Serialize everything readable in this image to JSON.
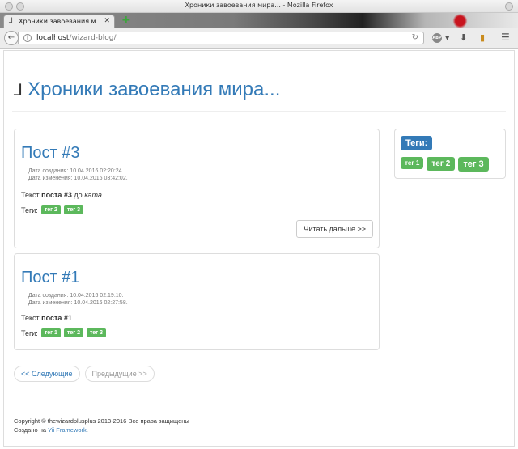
{
  "window": {
    "title": "Хроники завоевания мира... - Mozilla Firefox"
  },
  "browser": {
    "tab_title": "Хроники завоевания м...",
    "url_host": "localhost",
    "url_path": "/wizard-blog/",
    "abp_label": "ABP"
  },
  "site": {
    "title": "Хроники завоевания мира..."
  },
  "posts": [
    {
      "title": "Пост #3",
      "created": "Дата создания: 10.04.2016 02:20:24.",
      "modified": "Дата изменения: 10.04.2016 03:42:02.",
      "text_before": "Текст ",
      "text_bold": "поста #3",
      "text_middle": " до ",
      "text_italic": "ката",
      "text_after": ".",
      "tags_label": "Теги:",
      "tags": [
        "тег 2",
        "тег 3"
      ],
      "read_more": "Читать дальше >>"
    },
    {
      "title": "Пост #1",
      "created": "Дата создания: 10.04.2016 02:19:10.",
      "modified": "Дата изменения: 10.04.2016 02:27:58.",
      "text_before": "Текст ",
      "text_bold": "поста #1",
      "text_after": ".",
      "tags_label": "Теги:",
      "tags": [
        "тег 1",
        "тег 2",
        "тег 3"
      ]
    }
  ],
  "sidebar": {
    "heading": "Теги:",
    "tags": [
      "тег 1",
      "тег 2",
      "тег 3"
    ]
  },
  "pager": {
    "next": "<< Следующие",
    "prev": "Предыдущие >>"
  },
  "footer": {
    "copyright": "Copyright © thewizardplusplus 2013-2016 Все права защищены",
    "made_with": "Создано на ",
    "framework": "Yii Framework",
    "end": "."
  },
  "colors": {
    "link": "#337ab7",
    "tag": "#5cb85c"
  }
}
